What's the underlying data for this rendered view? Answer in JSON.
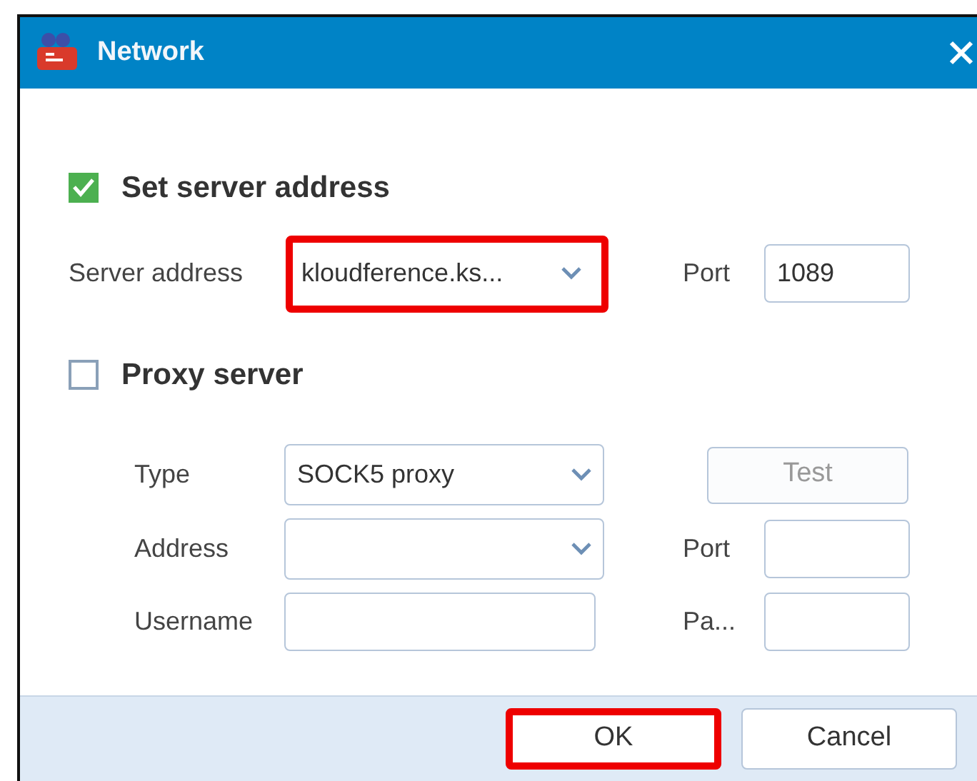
{
  "window": {
    "title": "Network"
  },
  "server": {
    "label": "Set server address",
    "checked": true,
    "address_label": "Server address",
    "address_value": "kloudference.ks...",
    "address_highlighted": true,
    "port_label": "Port",
    "port_value": "1089"
  },
  "proxy": {
    "label": "Proxy server",
    "checked": false,
    "type_label": "Type",
    "type_value": "SOCK5 proxy",
    "test_button": {
      "label": "Test",
      "disabled": true
    },
    "address_label": "Address",
    "port_label": "Port",
    "username_label": "Username",
    "password_label": "Pa..."
  },
  "buttons": [
    {
      "label": "OK",
      "highlighted": true
    },
    {
      "label": "Cancel",
      "highlighted": false
    }
  ]
}
